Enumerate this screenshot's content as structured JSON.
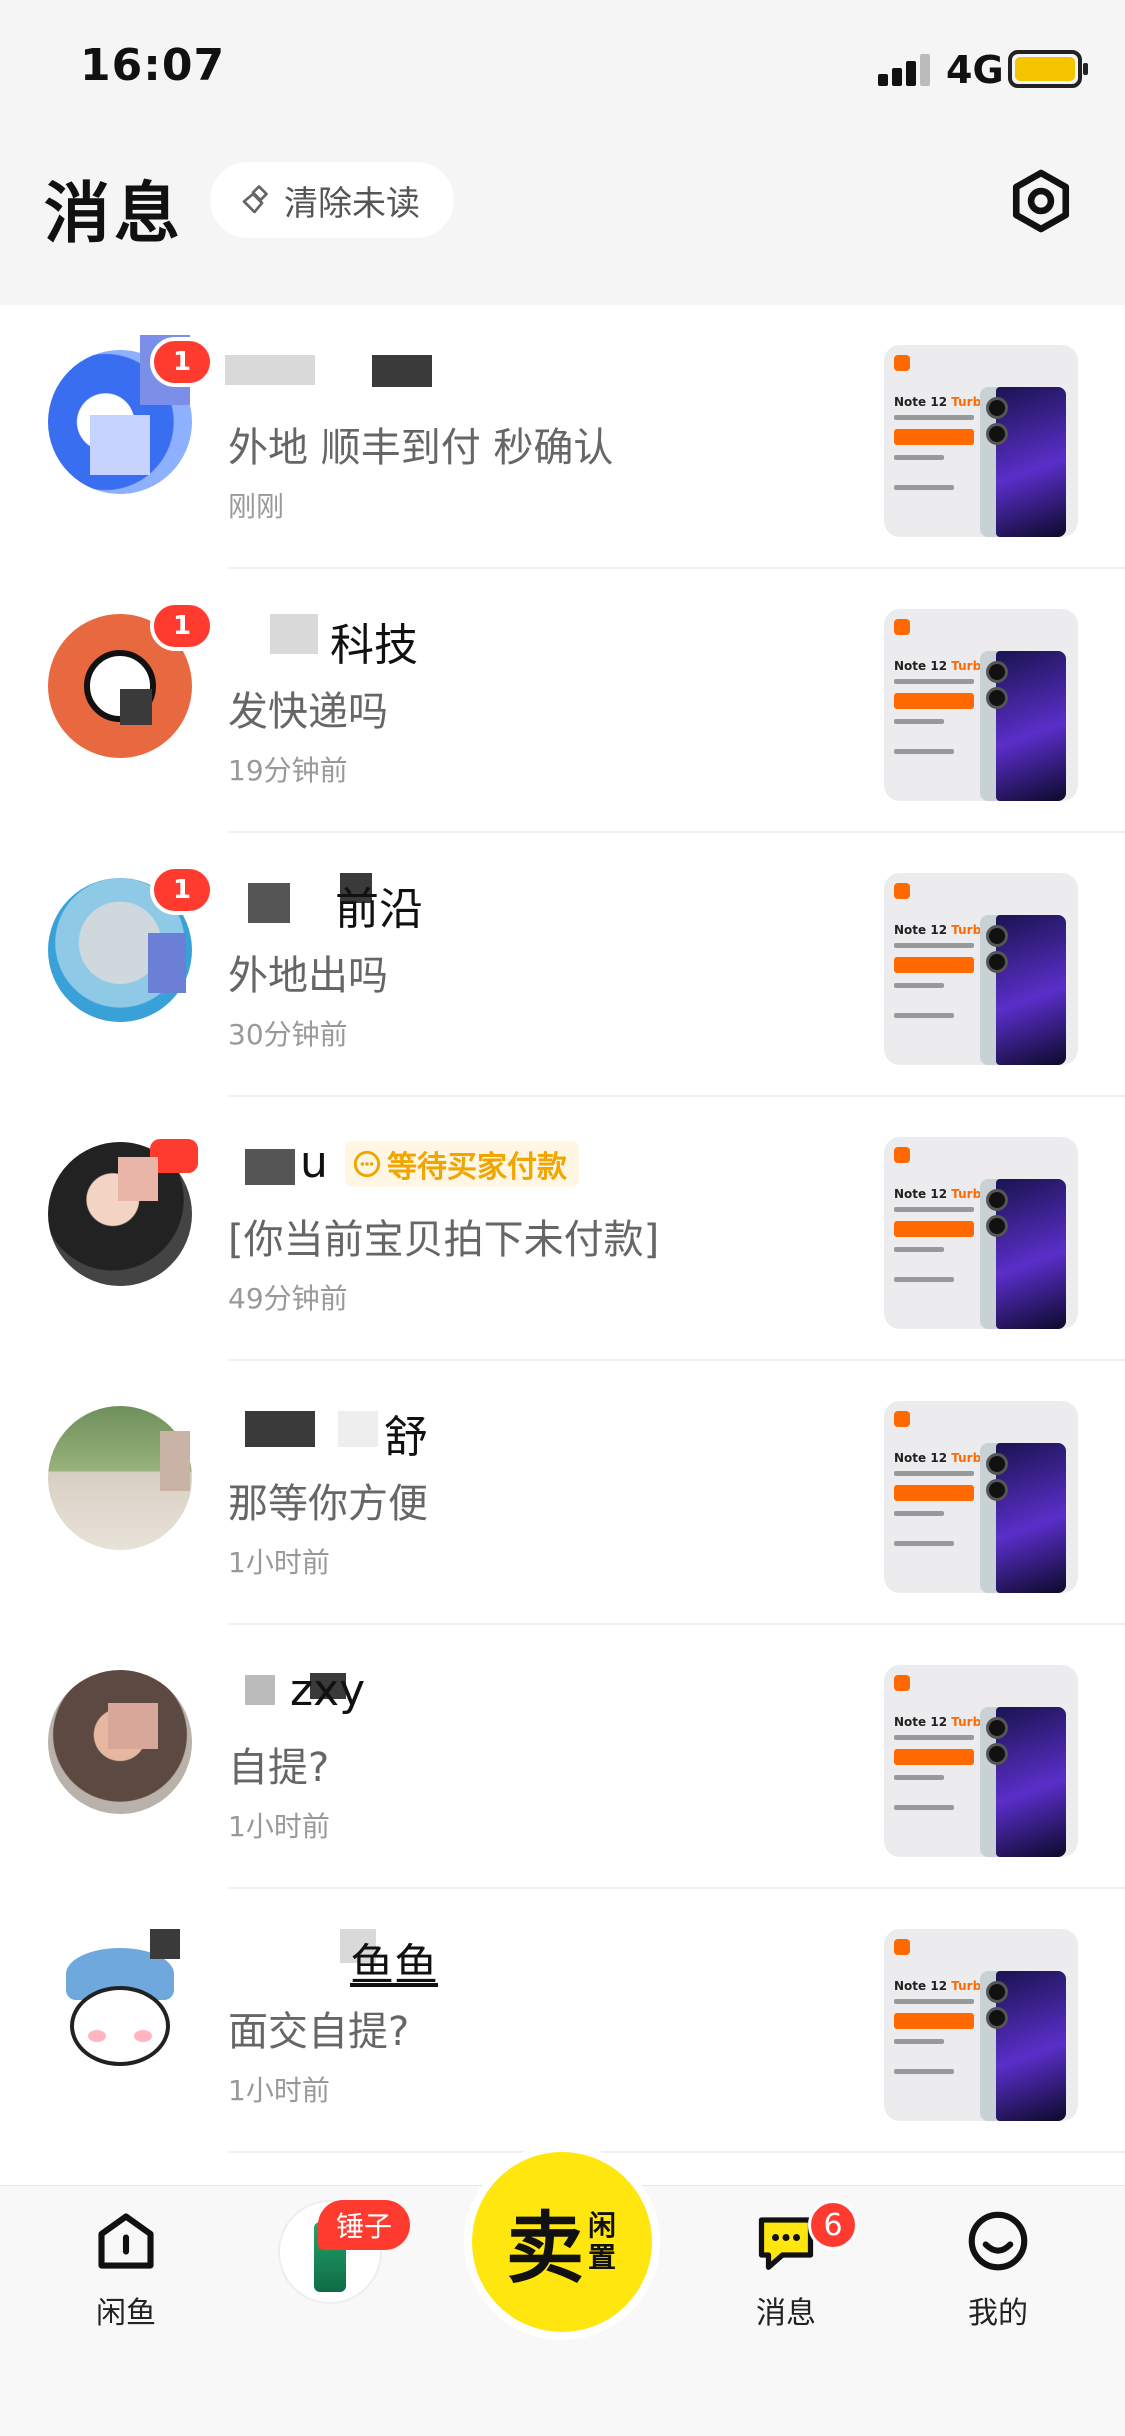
{
  "status_bar": {
    "time": "16:07",
    "network": "4G"
  },
  "header": {
    "title": "消息",
    "clear_unread_label": "清除未读"
  },
  "conversations": [
    {
      "name": "",
      "message": "外地 顺丰到付 秒确认",
      "time": "刚刚",
      "unread": "1"
    },
    {
      "name": "科技",
      "message": "发快递吗",
      "time": "19分钟前",
      "unread": "1"
    },
    {
      "name": "前沿",
      "message": "外地出吗",
      "time": "30分钟前",
      "unread": "1"
    },
    {
      "name": "u",
      "tag": "等待买家付款",
      "message": "[你当前宝贝拍下未付款]",
      "time": "49分钟前"
    },
    {
      "name": "舒",
      "message": "那等你方便",
      "time": "1小时前"
    },
    {
      "name": "zxy",
      "message": "自提?",
      "time": "1小时前"
    },
    {
      "name": "鱼鱼",
      "message": "面交自提?",
      "time": "1小时前"
    }
  ],
  "product_thumb": {
    "model": "Note 12",
    "suffix": "Turbo"
  },
  "tabbar": {
    "home_label": "闲鱼",
    "hammer_tag": "锤子",
    "sell_big": "卖",
    "sell_small": "闲置",
    "messages_label": "消息",
    "messages_badge": "6",
    "mine_label": "我的"
  },
  "colors": {
    "accent": "#ffe60f",
    "badge": "#ff3b30",
    "tag": "#f0a500"
  }
}
